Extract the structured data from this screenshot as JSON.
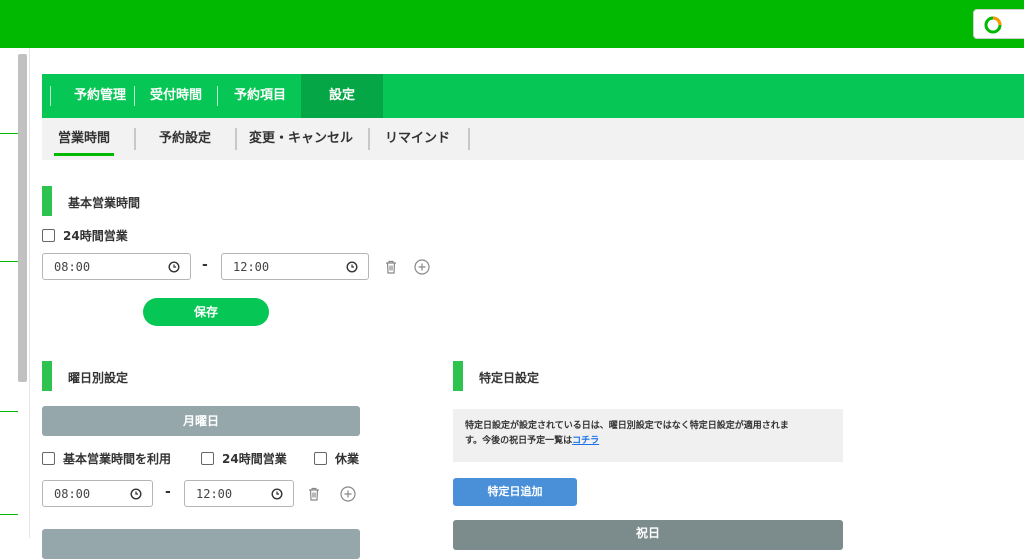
{
  "colors": {
    "brand": "#00b900",
    "tab_bg": "#06c755",
    "accent_bar": "#2ec24f",
    "day_header": "#95a7ab",
    "link": "#1a73e8",
    "add_button": "#4a90d9"
  },
  "tabs": [
    {
      "label": "予約管理",
      "active": false
    },
    {
      "label": "受付時間",
      "active": false
    },
    {
      "label": "予約項目",
      "active": false
    },
    {
      "label": "設定",
      "active": true
    }
  ],
  "subtabs": [
    {
      "label": "営業時間",
      "active": true
    },
    {
      "label": "予約設定",
      "active": false
    },
    {
      "label": "変更・キャンセル",
      "active": false
    },
    {
      "label": "リマインド",
      "active": false
    }
  ],
  "basic_hours": {
    "title": "基本営業時間",
    "checkbox_24h": "24時間営業",
    "start": "08:00",
    "dash": "-",
    "end": "12:00",
    "save_label": "保存"
  },
  "weekday": {
    "title": "曜日別設定",
    "monday": {
      "header": "月曜日",
      "use_basic": "基本営業時間を利用",
      "open_24h": "24時間営業",
      "closed": "休業",
      "start": "08:00",
      "dash": "-",
      "end": "12:00"
    }
  },
  "special": {
    "title": "特定日設定",
    "notice_line1": "特定日設定が設定されている日は、曜日別設定ではなく特定日設定が適用されま",
    "notice_line2": "す。今後の祝日予定一覧は",
    "notice_link": "コチラ",
    "add_label": "特定日追加",
    "holiday_header": "祝日"
  }
}
